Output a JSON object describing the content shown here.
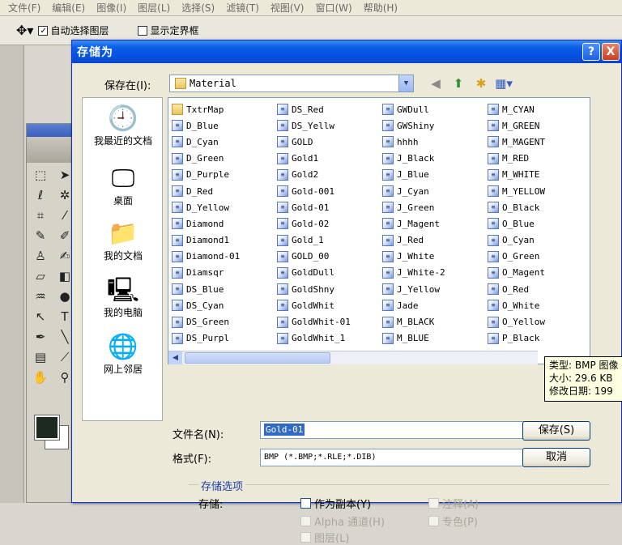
{
  "app": {
    "menu": [
      "文件(F)",
      "编辑(E)",
      "图像(I)",
      "图层(L)",
      "选择(S)",
      "滤镜(T)",
      "视图(V)",
      "窗口(W)",
      "帮助(H)"
    ],
    "options": {
      "auto_select_label": "自动选择图层",
      "show_bounds_label": "显示定界框"
    }
  },
  "dialog": {
    "title": "存储为",
    "help_button": "?",
    "close_button": "X",
    "save_in_label": "保存在(I):",
    "save_in_value": "Material",
    "places": {
      "recent": "我最近的文档",
      "desktop": "桌面",
      "documents": "我的文档",
      "computer": "我的电脑",
      "network": "网上邻居"
    },
    "files": {
      "col0": [
        "TxtrMap",
        "D_Blue",
        "D_Cyan",
        "D_Green",
        "D_Purple",
        "D_Red",
        "D_Yellow",
        "Diamond",
        "Diamond1",
        "Diamond-01",
        "Diamsqr",
        "DS_Blue",
        "DS_Cyan",
        "DS_Green",
        "DS_Purpl"
      ],
      "col1": [
        "DS_Red",
        "DS_Yellw",
        "GOLD",
        "Gold1",
        "Gold2",
        "Gold-001",
        "Gold-01",
        "Gold-02",
        "Gold_1",
        "GOLD_00",
        "GoldDull",
        "GoldShny",
        "GoldWhit",
        "GoldWhit-01",
        "GoldWhit_1"
      ],
      "col2": [
        "GWDull",
        "GWShiny",
        "hhhh",
        "J_Black",
        "J_Blue",
        "J_Cyan",
        "J_Green",
        "J_Magent",
        "J_Red",
        "J_White",
        "J_White-2",
        "J_Yellow",
        "Jade",
        "M_BLACK",
        "M_BLUE"
      ],
      "col3": [
        "M_CYAN",
        "M_GREEN",
        "M_MAGENT",
        "M_RED",
        "M_WHITE",
        "M_YELLOW",
        "O_Black",
        "O_Blue",
        "O_Cyan",
        "O_Green",
        "O_Magent",
        "O_Red",
        "O_White",
        "O_Yellow",
        "P_Black"
      ]
    },
    "tooltip": {
      "type": "类型: BMP 图像",
      "size": "大小: 29.6 KB",
      "modified": "修改日期: 199"
    },
    "filename_label": "文件名(N):",
    "filename_value": "Gold-01",
    "format_label": "格式(F):",
    "format_value": "BMP (*.BMP;*.RLE;*.DIB)",
    "save_button": "保存(S)",
    "cancel_button": "取消",
    "save_options": {
      "title": "存储选项",
      "label": "存储:",
      "as_copy": "作为副本(Y)",
      "annotations": "注释(A)",
      "alpha": "Alpha 通道(H)",
      "spot": "专色(P)",
      "layers": "图层(L)"
    }
  }
}
